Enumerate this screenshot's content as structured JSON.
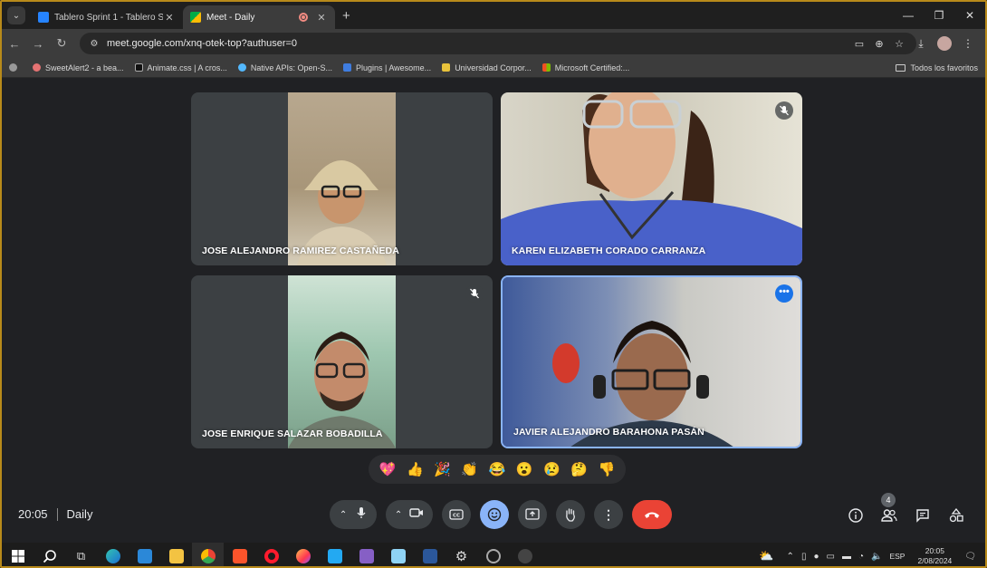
{
  "browser": {
    "tabs": [
      {
        "title": "Tablero Sprint 1 - Tablero STA -",
        "active": false
      },
      {
        "title": "Meet - Daily",
        "active": true
      }
    ],
    "url": "meet.google.com/xnq-otek-top?authuser=0",
    "bookmarks": [
      "SweetAlert2 - a bea...",
      "Animate.css | A cros...",
      "Native APIs: Open-S...",
      "Plugins | Awesome...",
      "Universidad Corpor...",
      "Microsoft Certified:..."
    ],
    "all_bookmarks": "Todos los favoritos"
  },
  "meet": {
    "participants": [
      {
        "name": "JOSE ALEJANDRO RAMIREZ CASTAÑEDA",
        "muted": false,
        "speaking": false
      },
      {
        "name": "KAREN ELIZABETH CORADO CARRANZA",
        "muted": true,
        "speaking": false
      },
      {
        "name": "JOSE ENRIQUE SALAZAR BOBADILLA",
        "muted": true,
        "speaking": false
      },
      {
        "name": "JAVIER ALEJANDRO BARAHONA PASÁN",
        "muted": false,
        "speaking": true
      }
    ],
    "reactions": [
      "💖",
      "👍",
      "🎉",
      "👏",
      "😂",
      "😮",
      "😢",
      "🤔",
      "👎"
    ],
    "time": "20:05",
    "meeting_name": "Daily",
    "people_count": "4",
    "end_call_color": "#ea4335",
    "active_color": "#8ab4f8"
  },
  "taskbar": {
    "lang": "ESP",
    "time": "20:05",
    "date": "2/08/2024"
  }
}
